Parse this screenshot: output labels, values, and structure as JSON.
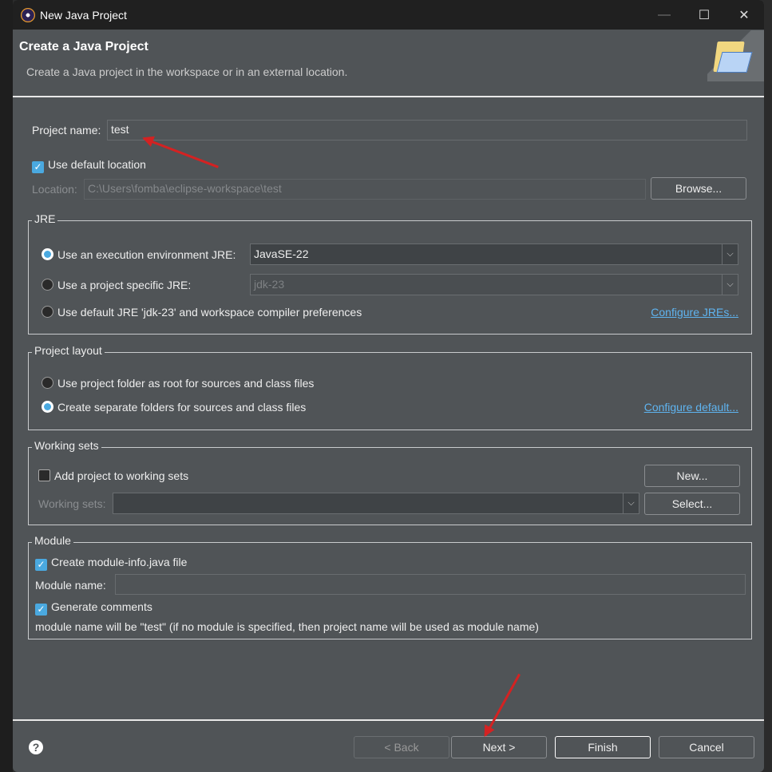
{
  "window": {
    "title": "New Java Project",
    "minimize": "—",
    "maximize": "☐",
    "close": "✕"
  },
  "header": {
    "title": "Create a Java Project",
    "description": "Create a Java project in the workspace or in an external location."
  },
  "project": {
    "name_label": "Project name:",
    "name_value": "test",
    "use_default_label": "Use default location",
    "use_default_checked": true,
    "location_label": "Location:",
    "location_value": "C:\\Users\\fomba\\eclipse-workspace\\test",
    "browse": "Browse..."
  },
  "jre": {
    "title": "JRE",
    "opt1": "Use an execution environment JRE:",
    "opt1_value": "JavaSE-22",
    "opt2": "Use a project specific JRE:",
    "opt2_value": "jdk-23",
    "opt3": "Use default JRE 'jdk-23' and workspace compiler preferences",
    "configure": "Configure JREs...",
    "selected": "opt1"
  },
  "layout": {
    "title": "Project layout",
    "opt1": "Use project folder as root for sources and class files",
    "opt2": "Create separate folders for sources and class files",
    "configure": "Configure default...",
    "selected": "opt2"
  },
  "working_sets": {
    "title": "Working sets",
    "add_label": "Add project to working sets",
    "add_checked": false,
    "new": "New...",
    "sets_label": "Working sets:",
    "select": "Select..."
  },
  "module": {
    "title": "Module",
    "create_label": "Create module-info.java file",
    "create_checked": true,
    "name_label": "Module name:",
    "name_value": "",
    "comments_label": "Generate comments",
    "comments_checked": true,
    "info": "module name will be \"test\"  (if no module is specified, then project name will be used as module name)"
  },
  "footer": {
    "help": "?",
    "back": "< Back",
    "next": "Next >",
    "finish": "Finish",
    "cancel": "Cancel"
  },
  "colors": {
    "accent": "#4aa9e0",
    "annotation_arrow": "#d42222",
    "link": "#5fb4f0"
  }
}
